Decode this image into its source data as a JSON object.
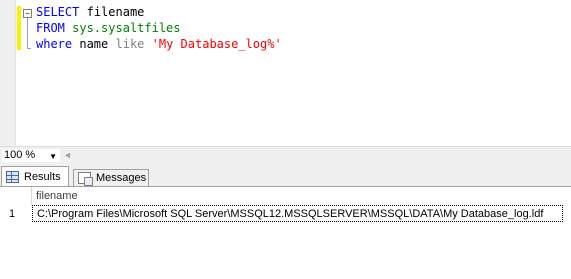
{
  "editor": {
    "collapse_symbol": "−",
    "line1": {
      "kw": "SELECT",
      "ident": "filename"
    },
    "line2": {
      "kw": "FROM",
      "obj": "sys.sysaltfiles"
    },
    "line3": {
      "kw": "where",
      "ident": "name",
      "op": "like",
      "str": "'My Database_log%'"
    }
  },
  "zoom": {
    "value": "100 %",
    "arrow": "▼",
    "scroll_left": "◄"
  },
  "tabs": [
    {
      "label": "Results",
      "icon": "results-grid-icon"
    },
    {
      "label": "Messages",
      "icon": "messages-icon"
    }
  ],
  "results": {
    "columns": [
      "filename"
    ],
    "rows": [
      {
        "num": "1",
        "filename": "C:\\Program Files\\Microsoft SQL Server\\MSSQL12.MSSQLSERVER\\MSSQL\\DATA\\My Database_log.ldf"
      }
    ]
  },
  "colors": {
    "keyword": "#0000ff",
    "object": "#008000",
    "string": "#ff0000",
    "operator": "#808080",
    "change_bar": "#ffef00"
  }
}
